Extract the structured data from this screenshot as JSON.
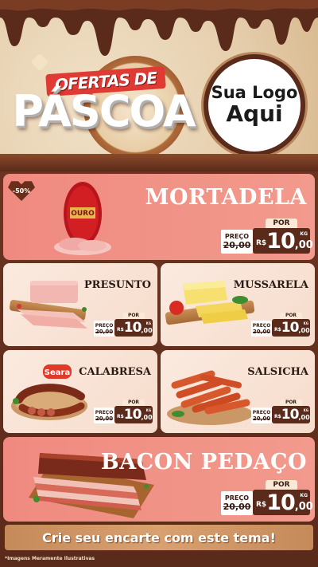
{
  "header": {
    "title_top": "OFERTAS DE",
    "title_main": "PÁSCOA",
    "logo_line1": "Sua Logo",
    "logo_line2": "Aqui"
  },
  "colors": {
    "chocolate": "#5a2a1a",
    "salmon": "#f08a80",
    "cream": "#fbeadf",
    "cta": "#d9a070"
  },
  "price_labels": {
    "old_label": "PREÇO",
    "new_label": "POR",
    "currency": "R$",
    "unit": "KG"
  },
  "products": {
    "mortadela": {
      "name": "MORTADELA",
      "discount": "-50%",
      "brand": "OURO",
      "old_price": "20,00",
      "price_int": "10",
      "price_dec": ",00"
    },
    "presunto": {
      "name": "PRESUNTO",
      "old_price": "20,00",
      "price_int": "10",
      "price_dec": ",00"
    },
    "mussarela": {
      "name": "MUSSARELA",
      "old_price": "20,00",
      "price_int": "10",
      "price_dec": ",00"
    },
    "calabresa": {
      "name": "CALABRESA",
      "brand": "Seara",
      "old_price": "20,00",
      "price_int": "10",
      "price_dec": ",00"
    },
    "salsicha": {
      "name": "SALSICHA",
      "old_price": "20,00",
      "price_int": "10",
      "price_dec": ",00"
    },
    "bacon": {
      "name": "BACON PEDAÇO",
      "old_price": "20,00",
      "price_int": "10",
      "price_dec": ",00"
    }
  },
  "cta": {
    "label": "Crie seu encarte com este tema!"
  },
  "footer": {
    "disclaimer": "*Imagens Meramente Ilustrativas"
  }
}
